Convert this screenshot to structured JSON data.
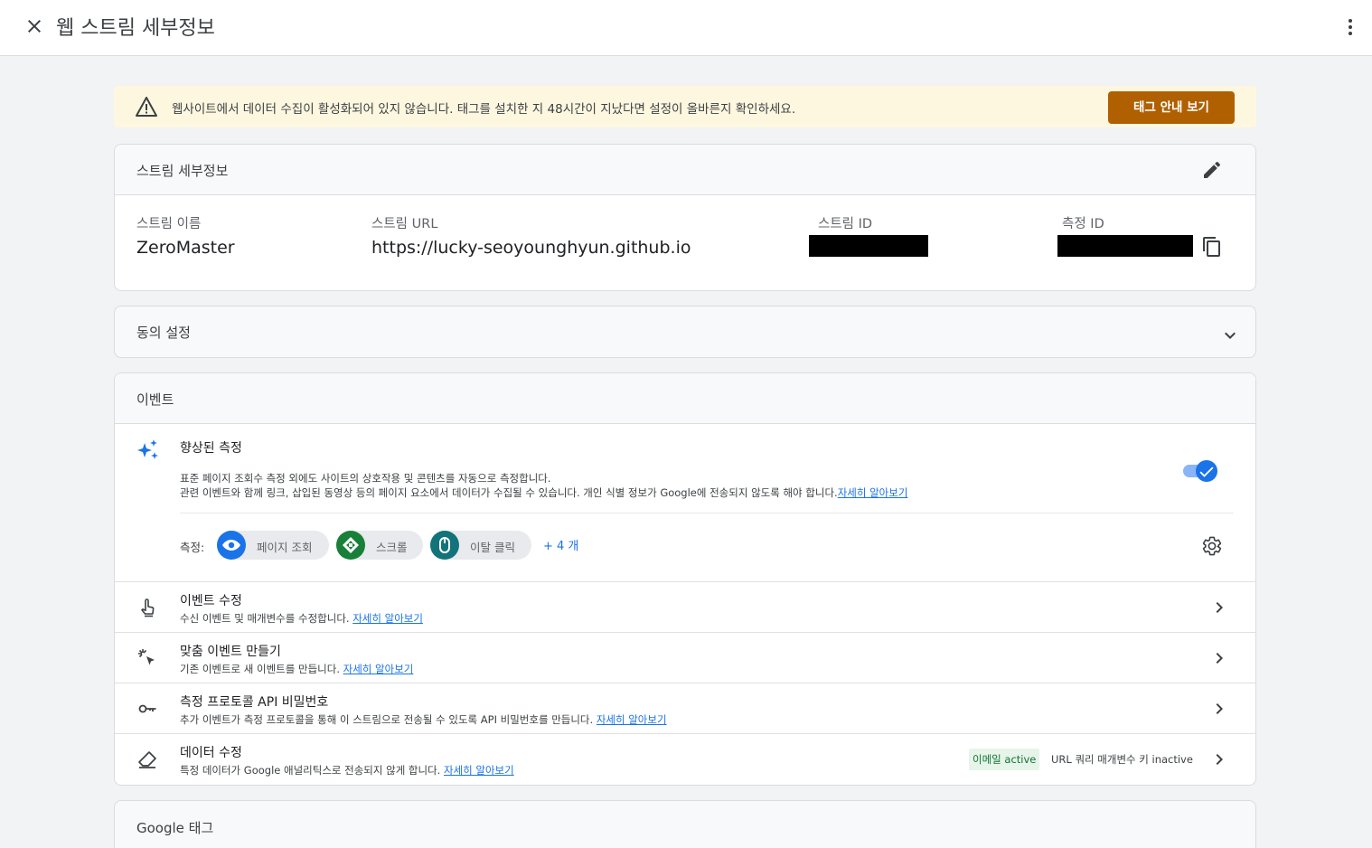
{
  "header": {
    "title": "웹 스트림 세부정보",
    "close_icon": "close-icon",
    "more_icon": "more-vert-icon"
  },
  "banner": {
    "message": "웹사이트에서 데이터 수집이 활성화되어 있지 않습니다. 태그를 설치한 지 48시간이 지났다면 설정이 올바른지 확인하세요.",
    "button_label": "태그 안내 보기",
    "colors": {
      "background": "#fef7e0",
      "button": "#b06000"
    }
  },
  "stream_details": {
    "heading": "스트림 세부정보",
    "name_label": "스트림 이름",
    "name_value": "ZeroMaster",
    "url_label": "스트림 URL",
    "url_value": "https://lucky-seoyounghyun.github.io",
    "stream_id_label": "스트림 ID",
    "measurement_id_label": "측정 ID"
  },
  "consent": {
    "heading": "동의 설정"
  },
  "events": {
    "heading": "이벤트",
    "enhanced": {
      "title": "향상된 측정",
      "desc_line1": "표준 페이지 조회수 측정 외에도 사이트의 상호작용 및 콘텐츠를 자동으로 측정합니다.",
      "desc_line2": "관련 이벤트와 함께 링크, 삽입된 동영상 등의 페이지 요소에서 데이터가 수집될 수 있습니다. 개인 식별 정보가 Google에 전송되지 않도록 해야 합니다.",
      "learn_more": "자세히 알아보기",
      "measure_label": "측정:",
      "chips": [
        {
          "label": "페이지 조회",
          "color": "#1a73e8"
        },
        {
          "label": "스크롤",
          "color": "#188038"
        },
        {
          "label": "이탈 클릭",
          "color": "#12737a"
        }
      ],
      "more": "+ 4 개"
    },
    "rows": [
      {
        "title": "이벤트 수정",
        "desc": "수신 이벤트 및 매개변수를 수정합니다.",
        "link": "자세히 알아보기"
      },
      {
        "title": "맞춤 이벤트 만들기",
        "desc": "기존 이벤트로 새 이벤트를 만듭니다.",
        "link": "자세히 알아보기"
      },
      {
        "title": "측정 프로토콜 API 비밀번호",
        "desc": "추가 이벤트가 측정 프로토콜을 통해 이 스트림으로 전송될 수 있도록 API 비밀번호를 만듭니다.",
        "link": "자세히 알아보기"
      },
      {
        "title": "데이터 수정",
        "desc": "특정 데이터가 Google 애널리틱스로 전송되지 않게 합니다.",
        "link": "자세히 알아보기"
      }
    ],
    "redaction_badges": {
      "email": "이메일 active",
      "url_query": "URL 쿼리 매개변수 키 inactive"
    }
  },
  "google_tag": {
    "heading": "Google 태그"
  }
}
